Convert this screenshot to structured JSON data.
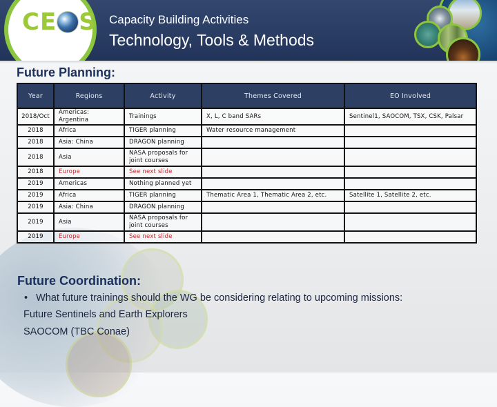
{
  "header": {
    "logo_text_left": "CE",
    "logo_text_right": "S",
    "subtitle": "Capacity Building Activities",
    "title": "Technology, Tools & Methods"
  },
  "planning": {
    "heading": "Future Planning:",
    "columns": [
      "Year",
      "Regions",
      "Activity",
      "Themes Covered",
      "EO Involved"
    ],
    "rows": [
      {
        "year": "2018/Oct",
        "region": "Americas: Argentina",
        "activity": "Trainings",
        "themes": "X, L, C band SARs",
        "eo": "Sentinel1, SAOCOM, TSX, CSK, Palsar",
        "highlight": false
      },
      {
        "year": "2018",
        "region": "Africa",
        "activity": "TIGER planning",
        "themes": "Water resource management",
        "eo": "",
        "highlight": false
      },
      {
        "year": "2018",
        "region": "Asia: China",
        "activity": "DRAGON planning",
        "themes": "",
        "eo": "",
        "highlight": false
      },
      {
        "year": "2018",
        "region": "Asia",
        "activity": "NASA proposals for joint courses",
        "themes": "",
        "eo": "",
        "highlight": false
      },
      {
        "year": "2018",
        "region": "Europe",
        "activity": "See next slide",
        "themes": "",
        "eo": "",
        "highlight": true
      },
      {
        "year": "2019",
        "region": "Americas",
        "activity": "Nothing planned yet",
        "themes": "",
        "eo": "",
        "highlight": false
      },
      {
        "year": "2019",
        "region": "Africa",
        "activity": "TIGER planning",
        "themes": "Thematic Area 1, Thematic Area 2, etc.",
        "eo": "Satellite 1, Satellite 2, etc.",
        "highlight": false
      },
      {
        "year": "2019",
        "region": "Asia: China",
        "activity": "DRAGON planning",
        "themes": "",
        "eo": "",
        "highlight": false
      },
      {
        "year": "2019",
        "region": "Asia",
        "activity": "NASA proposals for joint courses",
        "themes": "",
        "eo": "",
        "highlight": false
      },
      {
        "year": "2019",
        "region": "Europe",
        "activity": "See next slide",
        "themes": "",
        "eo": "",
        "highlight": true
      }
    ]
  },
  "coordination": {
    "heading": "Future Coordination:",
    "bullet_glyph": "•",
    "bullet": "What future trainings should the WG be considering relating to upcoming missions:",
    "lines": [
      "Future Sentinels and Earth Explorers",
      "SAOCOM (TBC Conae)"
    ]
  },
  "colors": {
    "banner": "#2a3d63",
    "logo_green": "#8cc63f",
    "heading_navy": "#1b2f5c",
    "table_header": "#2d4064",
    "highlight_red": "#c1272d"
  }
}
